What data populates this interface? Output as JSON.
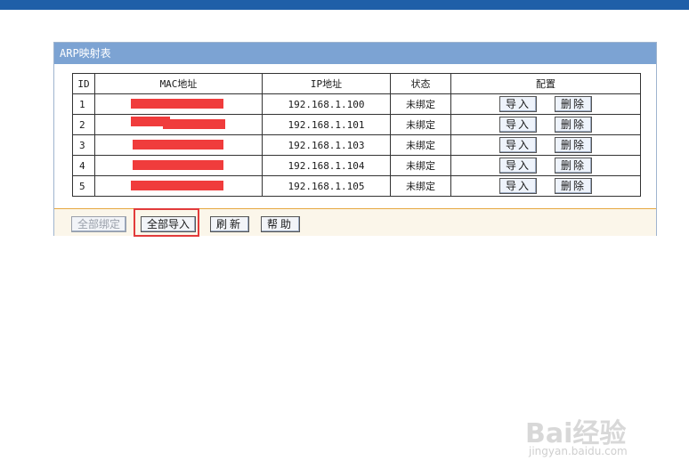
{
  "panel": {
    "title": "ARP映射表"
  },
  "table": {
    "headers": [
      "ID",
      "MAC地址",
      "IP地址",
      "状态",
      "配置"
    ],
    "rows": [
      {
        "id": "1",
        "ip": "192.168.1.100",
        "status": "未绑定"
      },
      {
        "id": "2",
        "ip": "192.168.1.101",
        "status": "未绑定"
      },
      {
        "id": "3",
        "ip": "192.168.1.103",
        "status": "未绑定"
      },
      {
        "id": "4",
        "ip": "192.168.1.104",
        "status": "未绑定"
      },
      {
        "id": "5",
        "ip": "192.168.1.105",
        "status": "未绑定"
      }
    ],
    "import_label": "导入",
    "delete_label": "删除"
  },
  "footer": {
    "bind_all_label": "全部绑定",
    "import_all_label": "全部导入",
    "refresh_label": "刷新",
    "help_label": "帮助"
  },
  "watermark": {
    "brand": "Bai经验",
    "url": "jingyan.baidu.com"
  },
  "colors": {
    "accent": "#7ca3d3",
    "redaction": "#f03c3c",
    "highlight": "#e23b3b"
  }
}
